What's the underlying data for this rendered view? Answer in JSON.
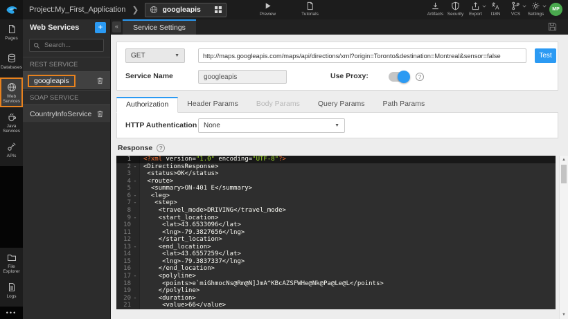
{
  "topbar": {
    "project_label": "Project:My_First_Application",
    "service_selector": {
      "value": "googleapis",
      "icon": "globe-icon",
      "grid_icon": "grid-icon"
    },
    "center_actions": [
      {
        "label": "Preview",
        "icon": "play-icon"
      },
      {
        "label": "Tutorials",
        "icon": "tutorials-icon"
      }
    ],
    "actions": [
      {
        "label": "Artifacts",
        "icon": "download-icon",
        "caret": false
      },
      {
        "label": "Security",
        "icon": "shield-icon",
        "caret": false
      },
      {
        "label": "Export",
        "icon": "export-icon",
        "caret": true
      },
      {
        "label": "I18N",
        "icon": "i18n-icon",
        "caret": false
      },
      {
        "label": "VCS",
        "icon": "vcs-icon",
        "caret": true
      },
      {
        "label": "Settings",
        "icon": "gear-icon",
        "caret": true
      }
    ],
    "avatar": "MP"
  },
  "activity_bar": {
    "items": [
      {
        "label": "Pages",
        "icon": "pages-icon",
        "active": false
      },
      {
        "label": "Databases",
        "icon": "database-icon",
        "active": false
      },
      {
        "label": "Web Services",
        "icon": "globe-icon",
        "active": true
      },
      {
        "label": "Java Services",
        "icon": "coffee-icon",
        "active": false
      },
      {
        "label": "APIs",
        "icon": "api-icon",
        "active": false
      }
    ],
    "bottom_items": [
      {
        "label": "File Explorer",
        "icon": "folder-icon",
        "active": false
      },
      {
        "label": "Logs",
        "icon": "logs-icon",
        "active": false
      }
    ],
    "more_label": "•••"
  },
  "services_panel": {
    "title": "Web Services",
    "add_button": "+",
    "collapse_button": "«",
    "search_placeholder": "Search...",
    "sections": [
      {
        "label": "REST SERVICE",
        "items": [
          {
            "name": "googleapis",
            "selected": true
          }
        ]
      },
      {
        "label": "SOAP SERVICE",
        "items": [
          {
            "name": "CountryInfoService",
            "selected": false
          }
        ]
      }
    ]
  },
  "editor": {
    "tab_label": "Service Settings"
  },
  "form": {
    "method": "GET",
    "url": "http://maps.googleapis.com/maps/api/directions/xml?origin=Toronto&destination=Montreal&sensor=false",
    "test_button": "Test",
    "service_name_label": "Service Name",
    "service_name_value": "googleapis",
    "use_proxy_label": "Use Proxy:",
    "use_proxy_on": true
  },
  "param_tabs": [
    {
      "label": "Authorization",
      "state": "active"
    },
    {
      "label": "Header Params",
      "state": "normal"
    },
    {
      "label": "Body Params",
      "state": "disabled"
    },
    {
      "label": "Query Params",
      "state": "normal"
    },
    {
      "label": "Path Params",
      "state": "normal"
    }
  ],
  "auth": {
    "label": "HTTP Authentication",
    "value": "None"
  },
  "response": {
    "label": "Response",
    "lines": [
      {
        "n": 1,
        "active": true,
        "fold": false,
        "seg": [
          [
            "decl",
            "<?xml"
          ],
          [
            "plain",
            " version="
          ],
          [
            "str",
            "\"1.0\""
          ],
          [
            "plain",
            " encoding="
          ],
          [
            "str",
            "\"UTF-8\""
          ],
          [
            "decl",
            "?>"
          ]
        ]
      },
      {
        "n": 2,
        "fold": true,
        "seg": [
          [
            "plain",
            "<DirectionsResponse>"
          ]
        ]
      },
      {
        "n": 3,
        "fold": false,
        "seg": [
          [
            "plain",
            " <status>OK</status>"
          ]
        ]
      },
      {
        "n": 4,
        "fold": true,
        "seg": [
          [
            "plain",
            " <route>"
          ]
        ]
      },
      {
        "n": 5,
        "fold": false,
        "seg": [
          [
            "plain",
            "  <summary>ON-401 E</summary>"
          ]
        ]
      },
      {
        "n": 6,
        "fold": true,
        "seg": [
          [
            "plain",
            "  <leg>"
          ]
        ]
      },
      {
        "n": 7,
        "fold": true,
        "seg": [
          [
            "plain",
            "   <step>"
          ]
        ]
      },
      {
        "n": 8,
        "fold": false,
        "seg": [
          [
            "plain",
            "    <travel_mode>DRIVING</travel_mode>"
          ]
        ]
      },
      {
        "n": 9,
        "fold": true,
        "seg": [
          [
            "plain",
            "    <start_location>"
          ]
        ]
      },
      {
        "n": 10,
        "fold": false,
        "seg": [
          [
            "plain",
            "     <lat>43.6533096</lat>"
          ]
        ]
      },
      {
        "n": 11,
        "fold": false,
        "seg": [
          [
            "plain",
            "     <lng>-79.3827656</lng>"
          ]
        ]
      },
      {
        "n": 12,
        "fold": false,
        "seg": [
          [
            "plain",
            "    </start_location>"
          ]
        ]
      },
      {
        "n": 13,
        "fold": true,
        "seg": [
          [
            "plain",
            "    <end_location>"
          ]
        ]
      },
      {
        "n": 14,
        "fold": false,
        "seg": [
          [
            "plain",
            "     <lat>43.6557259</lat>"
          ]
        ]
      },
      {
        "n": 15,
        "fold": false,
        "seg": [
          [
            "plain",
            "     <lng>-79.3837337</lng>"
          ]
        ]
      },
      {
        "n": 16,
        "fold": false,
        "seg": [
          [
            "plain",
            "    </end_location>"
          ]
        ]
      },
      {
        "n": 17,
        "fold": true,
        "seg": [
          [
            "plain",
            "    <polyline>"
          ]
        ]
      },
      {
        "n": 18,
        "fold": false,
        "seg": [
          [
            "plain",
            "     <points>e`miGhmocNs@Rm@N]JmA^KBcAZSFWHe@Nk@Pa@Le@L</points>"
          ]
        ]
      },
      {
        "n": 19,
        "fold": false,
        "seg": [
          [
            "plain",
            "    </polyline>"
          ]
        ]
      },
      {
        "n": 20,
        "fold": true,
        "seg": [
          [
            "plain",
            "    <duration>"
          ]
        ]
      },
      {
        "n": 21,
        "fold": false,
        "seg": [
          [
            "plain",
            "     <value>66</value>"
          ]
        ]
      }
    ]
  },
  "colors": {
    "accent_blue": "#2b9af3",
    "selection_orange": "#e8821e",
    "avatar_green": "#4aa94e",
    "code_background": "#2e2e2e",
    "code_string_green": "#a6e22e",
    "code_decl_orange": "#ef7035"
  }
}
